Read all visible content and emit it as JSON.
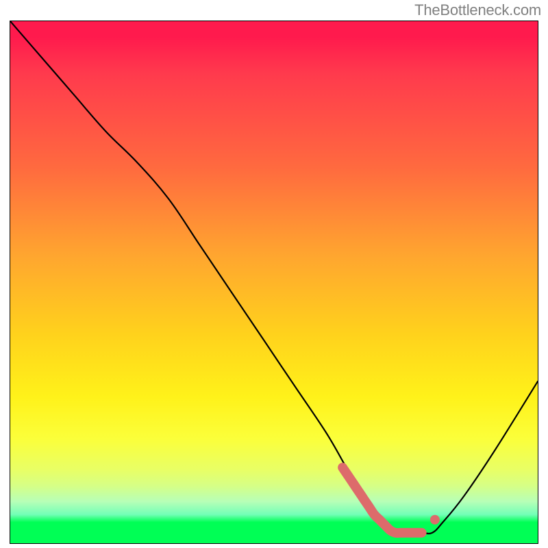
{
  "watermark": "TheBottleneck.com",
  "chart_data": {
    "type": "line",
    "title": "",
    "xlabel": "",
    "ylabel": "",
    "xlim": [
      0,
      100
    ],
    "ylim": [
      0,
      100
    ],
    "grid": false,
    "legend": false,
    "series": [
      {
        "name": "main-curve",
        "color": "#000000",
        "x": [
          0,
          6,
          12,
          18,
          24,
          30,
          36,
          42,
          48,
          54,
          60,
          64,
          66,
          68,
          70,
          72,
          74,
          76,
          78,
          80,
          82,
          86,
          92,
          100
        ],
        "y": [
          100,
          93,
          86,
          79,
          73,
          66,
          57,
          48,
          39,
          30,
          21,
          14,
          11,
          8,
          5,
          3,
          2,
          2,
          2,
          2,
          4,
          9,
          18,
          31
        ]
      },
      {
        "name": "low-band-segment",
        "color": "#e26a6a",
        "x": [
          63,
          64,
          65,
          66,
          67,
          68,
          69,
          70,
          71,
          72,
          73,
          74,
          75,
          76,
          77,
          78
        ],
        "y": [
          14.5,
          13,
          11.5,
          10,
          8.5,
          7,
          5.5,
          4.5,
          3.5,
          2.5,
          2,
          2,
          2,
          2,
          2,
          2
        ]
      },
      {
        "name": "low-band-dot",
        "color": "#e26a6a",
        "x": [
          80.5
        ],
        "y": [
          4.5
        ]
      }
    ],
    "background_gradient": {
      "orientation": "vertical",
      "stops": [
        {
          "offset": 0.0,
          "color": "#ff1a4d"
        },
        {
          "offset": 0.28,
          "color": "#ff6a3f"
        },
        {
          "offset": 0.6,
          "color": "#ffd21c"
        },
        {
          "offset": 0.8,
          "color": "#fbff3a"
        },
        {
          "offset": 0.92,
          "color": "#b7ffb7"
        },
        {
          "offset": 0.96,
          "color": "#00ff55"
        },
        {
          "offset": 1.0,
          "color": "#00ff55"
        }
      ]
    }
  }
}
